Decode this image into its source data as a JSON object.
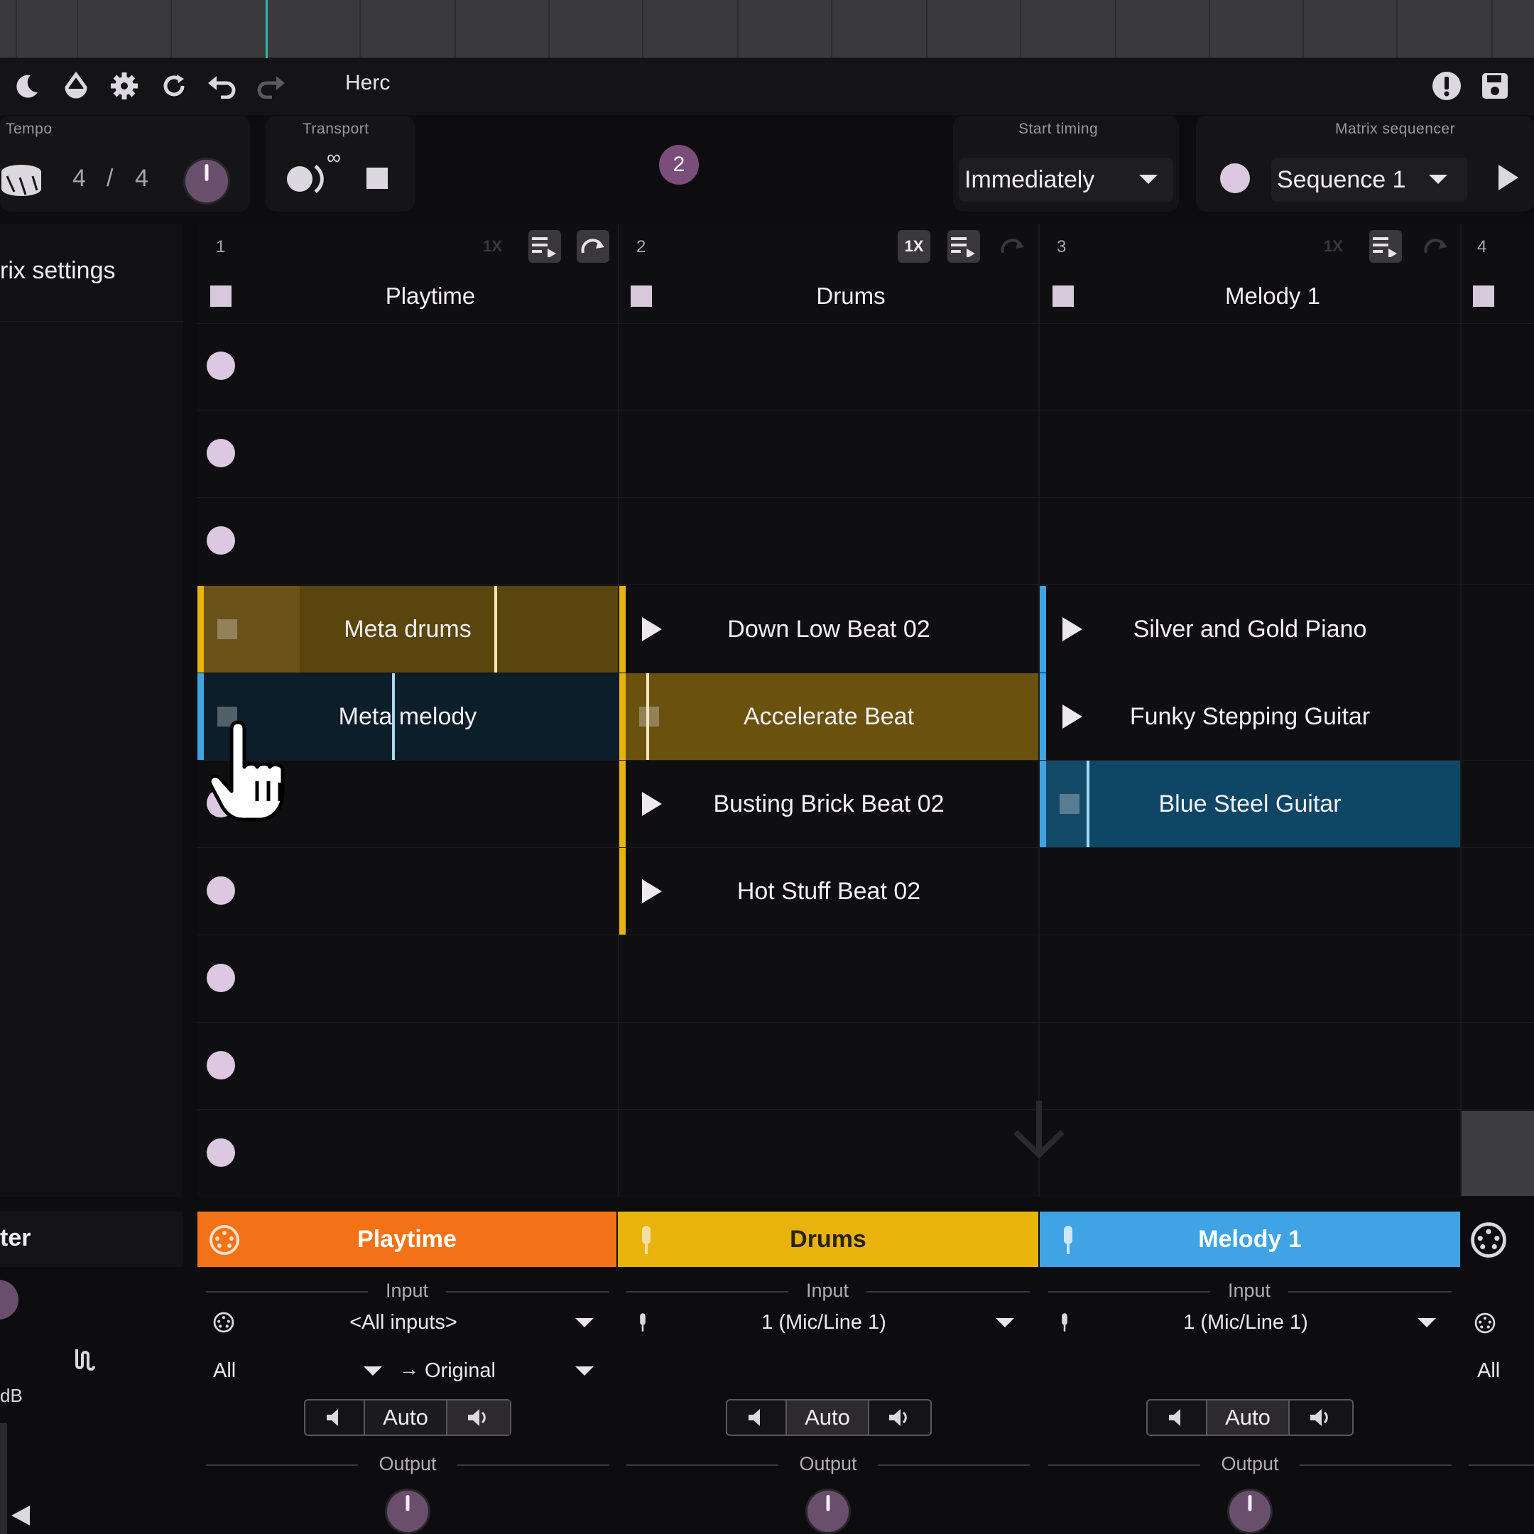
{
  "toolbar": {
    "title": "Herc",
    "icons": [
      "moon-icon",
      "drop-icon",
      "gear-icon",
      "refresh-icon",
      "undo-icon",
      "redo-icon",
      "warning-icon",
      "save-icon"
    ]
  },
  "tempo": {
    "label": "Tempo",
    "sig_num": "4",
    "sig_slash": "/",
    "sig_den": "4"
  },
  "transport": {
    "label": "Transport",
    "infinity": "∞"
  },
  "badge": "2",
  "start_timing": {
    "label": "Start timing",
    "value": "Immediately"
  },
  "matrix_sequencer": {
    "label": "Matrix sequencer",
    "value": "Sequence 1"
  },
  "sidebar": {
    "settings_label": "rix settings",
    "lower_label": "ter",
    "db_label": "dB"
  },
  "columns": [
    {
      "num": "1",
      "oncelabel": "1X",
      "title": "Playtime"
    },
    {
      "num": "2",
      "oncelabel": "1X",
      "title": "Drums"
    },
    {
      "num": "3",
      "oncelabel": "1X",
      "title": "Melody 1"
    },
    {
      "num": "4"
    }
  ],
  "clips": {
    "c1r4": "Meta drums",
    "c1r5": "Meta melody",
    "c2r4": "Down Low Beat 02",
    "c2r5": "Accelerate Beat",
    "c2r6": "Busting Brick Beat 02",
    "c2r7": "Hot Stuff Beat 02",
    "c3r4": "Silver and Gold Piano",
    "c3r5": "Funky Stepping Guitar",
    "c3r6": "Blue Steel Guitar"
  },
  "tracks": [
    {
      "name": "Playtime",
      "color": "#f47216",
      "input_label": "Input",
      "input": "<All inputs>",
      "channel": "All",
      "arrow": "→",
      "mapping": "Original",
      "monitor": "Auto",
      "output_label": "Output"
    },
    {
      "name": "Drums",
      "color": "#e8b30c",
      "input_label": "Input",
      "input": "1 (Mic/Line 1)",
      "monitor": "Auto",
      "output_label": "Output"
    },
    {
      "name": "Melody 1",
      "color": "#3fa3e4",
      "input_label": "Input",
      "input": "1 (Mic/Line 1)",
      "monitor": "Auto",
      "output_label": "Output"
    }
  ],
  "track4": {
    "channel": "All"
  },
  "colors": {
    "accent": "#6a4f6c",
    "yellow_clip": "#5a450c",
    "blue_clip": "#0e4766",
    "dark_blue_clip": "#0b1e2a"
  }
}
